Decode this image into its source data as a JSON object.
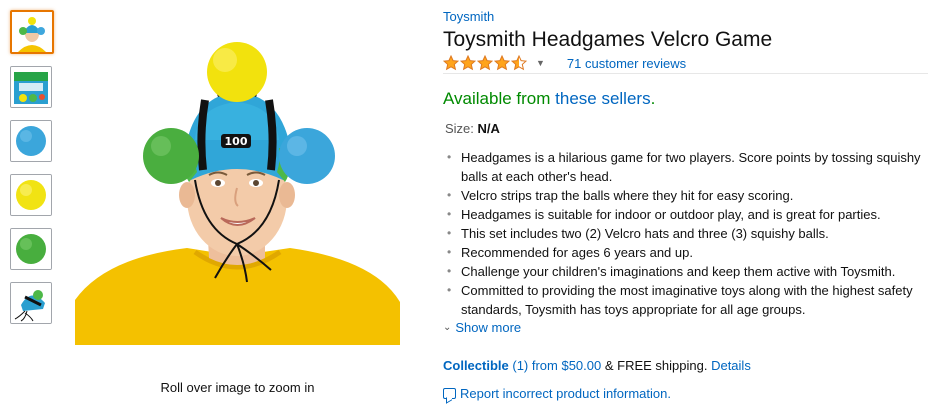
{
  "colors": {
    "link": "#0066c0",
    "availability_green": "#008a00",
    "star": "#ffa41c",
    "active_thumb": "#e77600"
  },
  "thumbnails": [
    {
      "name": "thumb-product-photo",
      "icon": "kid-with-headgear"
    },
    {
      "name": "thumb-box",
      "icon": "game-box"
    },
    {
      "name": "thumb-blue-ball",
      "icon": "blue-ball"
    },
    {
      "name": "thumb-yellow-ball",
      "icon": "yellow-ball"
    },
    {
      "name": "thumb-green-ball",
      "icon": "green-ball"
    },
    {
      "name": "thumb-hat",
      "icon": "velcro-hat"
    }
  ],
  "zoom_hint": "Roll over image to zoom in",
  "brand": "Toysmith",
  "title": "Toysmith Headgames Velcro Game",
  "rating": {
    "stars": 4.5,
    "max": 5,
    "reviews_text": "71 customer reviews"
  },
  "availability": {
    "prefix": "Available from ",
    "link": "these sellers",
    "suffix": "."
  },
  "size": {
    "label": "Size: ",
    "value": "N/A"
  },
  "bullets": [
    "Headgames is a hilarious game for two players. Score points by tossing squishy balls at each other's head.",
    "Velcro strips trap the balls where they hit for easy scoring.",
    "Headgames is suitable for indoor or outdoor play, and is great for parties.",
    "This set includes two (2) Velcro hats and three (3) squishy balls.",
    "Recommended for ages 6 years and up.",
    "Challenge your children's imaginations and keep them active with Toysmith.",
    "Committed to providing the most imaginative toys along with the highest safety standards, Toysmith has toys appropriate for all age groups."
  ],
  "show_more": "Show more",
  "offers": {
    "collectible": "Collectible",
    "count": " (1) from $50.00",
    "shipping": " & FREE shipping. ",
    "details": "Details"
  },
  "report": "Report incorrect product information."
}
